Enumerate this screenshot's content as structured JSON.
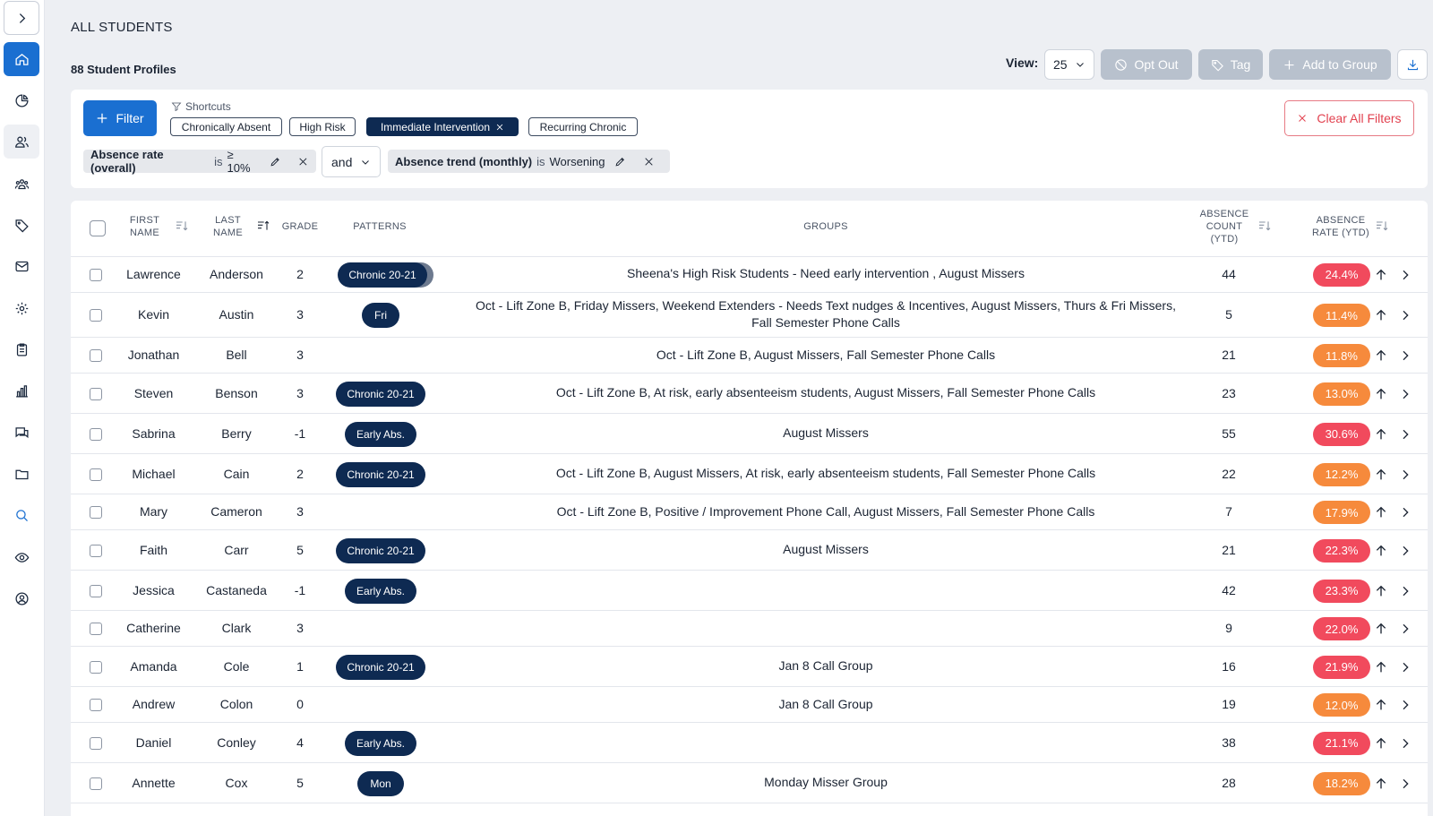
{
  "page": {
    "title": "ALL STUDENTS",
    "profile_count": "88 Student Profiles"
  },
  "sidebar": {
    "items": [
      {
        "icon": "chevron-right-icon"
      },
      {
        "icon": "home-icon"
      },
      {
        "icon": "pie-chart-icon"
      },
      {
        "icon": "users-icon"
      },
      {
        "icon": "group-icon"
      },
      {
        "icon": "tag-icon"
      },
      {
        "icon": "mail-icon"
      },
      {
        "icon": "gear-icon"
      },
      {
        "icon": "clipboard-icon"
      },
      {
        "icon": "bar-chart-icon"
      },
      {
        "icon": "chat-icon"
      },
      {
        "icon": "folder-icon"
      },
      {
        "icon": "search-icon"
      },
      {
        "icon": "eye-icon"
      },
      {
        "icon": "user-circle-icon"
      }
    ]
  },
  "toolbar": {
    "view_label": "View:",
    "view_value": "25",
    "opt_out": "Opt Out",
    "tag": "Tag",
    "add_to_group": "Add to Group"
  },
  "filters": {
    "filter_button": "Filter",
    "shortcuts_label": "Shortcuts",
    "shortcuts": [
      "Chronically Absent",
      "High Risk",
      "Immediate Intervention",
      "Recurring Chronic"
    ],
    "active_shortcut": "Immediate Intervention",
    "clear_all": "Clear All Filters",
    "conditions": [
      {
        "field": "Absence rate (overall)",
        "op": "is",
        "value": "≥ 10%"
      },
      {
        "field": "Absence trend (monthly)",
        "op": "is",
        "value": "Worsening"
      }
    ],
    "join": "and"
  },
  "table": {
    "headers": {
      "first_name": [
        "FIRST",
        "NAME"
      ],
      "last_name": [
        "LAST",
        "NAME"
      ],
      "grade": "GRADE",
      "patterns": "PATTERNS",
      "groups": "GROUPS",
      "absence_count": [
        "ABSENCE",
        "COUNT",
        "(YTD)"
      ],
      "absence_rate": [
        "ABSENCE",
        "RATE (YTD)"
      ]
    },
    "rows": [
      {
        "first": "Lawrence",
        "last": "Anderson",
        "grade": "2",
        "pattern": "Chronic 20-21",
        "groups": "Sheena's High Risk Students - Need early intervention , August Missers",
        "count": "44",
        "rate": "24.4%",
        "rate_color": "red"
      },
      {
        "first": "Kevin",
        "last": "Austin",
        "grade": "3",
        "pattern": "Fri",
        "groups": "Oct - Lift Zone B, Friday Missers, Weekend Extenders - Needs Text nudges & Incentives, August Missers, Thurs & Fri Missers, Fall Semester Phone Calls",
        "count": "5",
        "rate": "11.4%",
        "rate_color": "orange"
      },
      {
        "first": "Jonathan",
        "last": "Bell",
        "grade": "3",
        "pattern": "",
        "groups": "Oct - Lift Zone B, August Missers, Fall Semester Phone Calls",
        "count": "21",
        "rate": "11.8%",
        "rate_color": "orange"
      },
      {
        "first": "Steven",
        "last": "Benson",
        "grade": "3",
        "pattern": "Chronic 20-21",
        "groups": "Oct - Lift Zone B, At risk, early absenteeism students, August Missers, Fall Semester Phone Calls",
        "count": "23",
        "rate": "13.0%",
        "rate_color": "orange"
      },
      {
        "first": "Sabrina",
        "last": "Berry",
        "grade": "-1",
        "pattern": "Early Abs.",
        "groups": "August Missers",
        "count": "55",
        "rate": "30.6%",
        "rate_color": "red"
      },
      {
        "first": "Michael",
        "last": "Cain",
        "grade": "2",
        "pattern": "Chronic 20-21",
        "groups": "Oct - Lift Zone B, August Missers, At risk, early absenteeism students, Fall Semester Phone Calls",
        "count": "22",
        "rate": "12.2%",
        "rate_color": "orange"
      },
      {
        "first": "Mary",
        "last": "Cameron",
        "grade": "3",
        "pattern": "",
        "groups": "Oct - Lift Zone B, Positive / Improvement Phone Call, August Missers, Fall Semester Phone Calls",
        "count": "7",
        "rate": "17.9%",
        "rate_color": "orange"
      },
      {
        "first": "Faith",
        "last": "Carr",
        "grade": "5",
        "pattern": "Chronic 20-21",
        "groups": "August Missers",
        "count": "21",
        "rate": "22.3%",
        "rate_color": "red"
      },
      {
        "first": "Jessica",
        "last": "Castaneda",
        "grade": "-1",
        "pattern": "Early Abs.",
        "groups": "",
        "count": "42",
        "rate": "23.3%",
        "rate_color": "red"
      },
      {
        "first": "Catherine",
        "last": "Clark",
        "grade": "3",
        "pattern": "",
        "groups": "",
        "count": "9",
        "rate": "22.0%",
        "rate_color": "red"
      },
      {
        "first": "Amanda",
        "last": "Cole",
        "grade": "1",
        "pattern": "Chronic 20-21",
        "groups": "Jan 8 Call Group",
        "count": "16",
        "rate": "21.9%",
        "rate_color": "red"
      },
      {
        "first": "Andrew",
        "last": "Colon",
        "grade": "0",
        "pattern": "",
        "groups": "Jan 8 Call Group",
        "count": "19",
        "rate": "12.0%",
        "rate_color": "orange"
      },
      {
        "first": "Daniel",
        "last": "Conley",
        "grade": "4",
        "pattern": "Early Abs.",
        "groups": "",
        "count": "38",
        "rate": "21.1%",
        "rate_color": "red"
      },
      {
        "first": "Annette",
        "last": "Cox",
        "grade": "5",
        "pattern": "Mon",
        "groups": "Monday Misser Group",
        "count": "28",
        "rate": "18.2%",
        "rate_color": "orange"
      }
    ]
  },
  "colors": {
    "accent": "#1a6fd1",
    "navy": "#0e2a52",
    "rate_red": "#f14a5d",
    "rate_orange": "#f68a3c"
  }
}
